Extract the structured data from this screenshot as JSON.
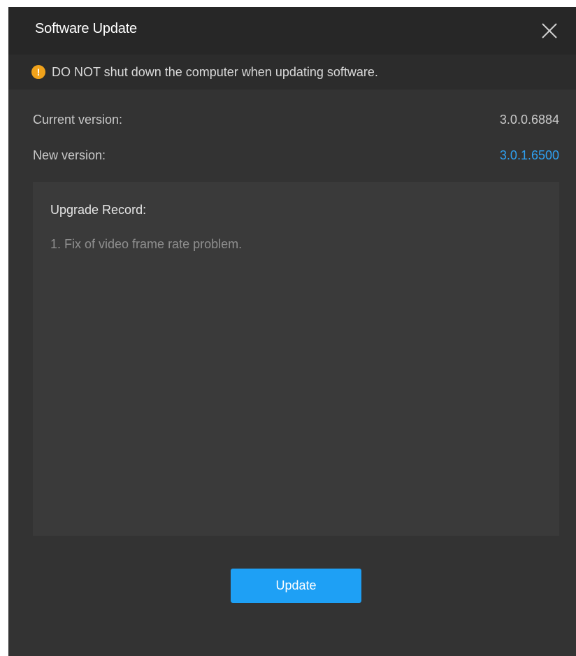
{
  "window": {
    "title": "Software Update",
    "close_icon": "close-icon"
  },
  "warning": {
    "icon": "exclamation-circle-icon",
    "icon_glyph": "!",
    "text": "DO NOT shut down the computer when updating software."
  },
  "versions": {
    "current_label": "Current version:",
    "current_value": "3.0.0.6884",
    "new_label": "New version:",
    "new_value": "3.0.1.6500"
  },
  "upgrade_record": {
    "title": "Upgrade Record:",
    "items": [
      "1.  Fix of video frame rate problem."
    ]
  },
  "actions": {
    "update_label": "Update"
  },
  "colors": {
    "accent": "#1ea0f5",
    "link_version": "#2fa0f0",
    "warning": "#f0a21b",
    "background": "#333333",
    "title_bar": "#272727"
  }
}
